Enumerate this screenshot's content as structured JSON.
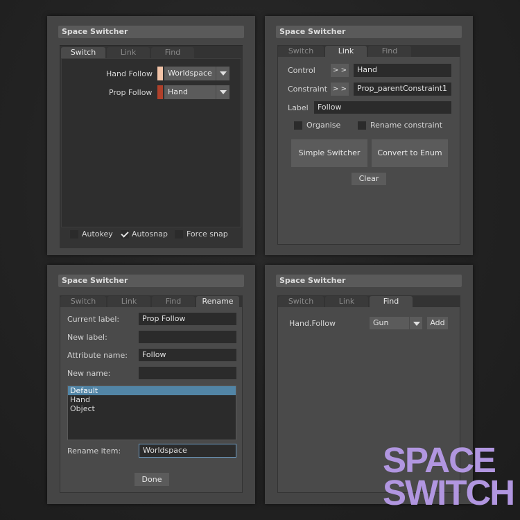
{
  "window_title": "Space Switcher",
  "tabs": {
    "switch": "Switch",
    "link": "Link",
    "find": "Find",
    "rename": "Rename"
  },
  "switch_panel": {
    "rows": [
      {
        "label": "Hand Follow",
        "swatch": "#f3c4a8",
        "value": "Worldspace"
      },
      {
        "label": "Prop Follow",
        "swatch": "#b0402a",
        "value": "Hand"
      }
    ],
    "options": [
      {
        "label": "Autokey",
        "checked": false
      },
      {
        "label": "Autosnap",
        "checked": true
      },
      {
        "label": "Force snap",
        "checked": false
      }
    ]
  },
  "link_panel": {
    "control_label": "Control",
    "control_value": "Hand",
    "constraint_label": "Constraint",
    "constraint_value": "Prop_parentConstraint1",
    "pick_button": "> >",
    "label_label": "Label",
    "label_value": "Follow",
    "organise_label": "Organise",
    "rename_constraint_label": "Rename constraint",
    "simple_switcher_button": "Simple Switcher",
    "convert_button": "Convert to Enum",
    "clear_button": "Clear"
  },
  "rename_panel": {
    "current_label_label": "Current label:",
    "current_label_value": "Prop Follow",
    "new_label_label": "New label:",
    "new_label_value": "",
    "attribute_name_label": "Attribute name:",
    "attribute_name_value": "Follow",
    "new_name_label": "New name:",
    "new_name_value": "",
    "items": [
      "Default",
      "Hand",
      "Object"
    ],
    "selected_item": "Default",
    "rename_item_label": "Rename item:",
    "rename_item_value": "Worldspace",
    "done_button": "Done"
  },
  "find_panel": {
    "attribute": "Hand.Follow",
    "value": "Gun",
    "add_button": "Add"
  },
  "brand": {
    "line1": "SPACE",
    "line2": "SWITCH",
    "color": "#b196e0"
  }
}
